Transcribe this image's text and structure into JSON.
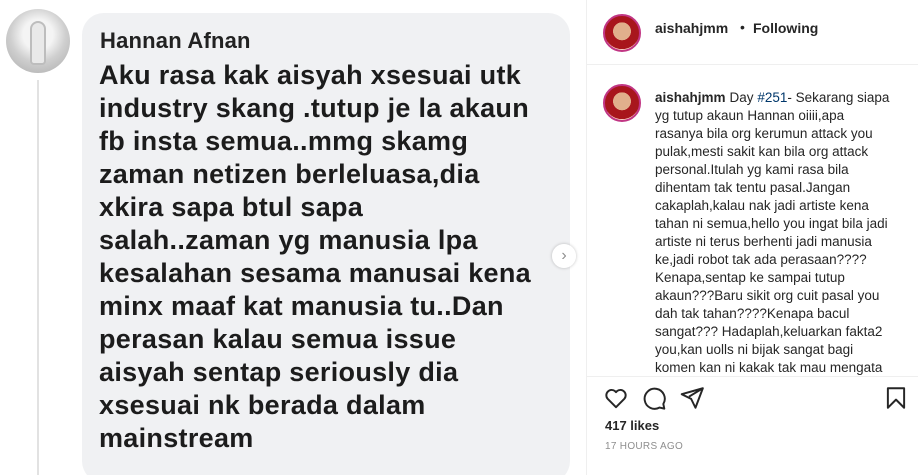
{
  "media": {
    "commenter": "Hannan Afnan",
    "comment_lines": [
      "Aku rasa kak aisyah xsesuai utk",
      "industry skang .tutup je la akaun",
      "fb insta semua..mmg skamg",
      "zaman netizen berleluasa,dia",
      "xkira sapa btul sapa",
      "salah..zaman yg manusia lpa",
      "kesalahan sesama manusai kena",
      "minx maaf kat manusia tu..Dan",
      "perasan kalau semua issue",
      "aisyah sentap seriously dia",
      "xsesuai nk berada dalam",
      "mainstream"
    ]
  },
  "header": {
    "username": "aishahjmm",
    "separator": "•",
    "follow_status": "Following"
  },
  "caption": {
    "username": "aishahjmm",
    "prefix": "Day",
    "hashtag": "#251",
    "text": "- Sekarang siapa yg tutup akaun Hannan oiiii,apa rasanya bila org kerumun attack you pulak,mesti sakit kan bila org attack personal.Itulah yg kami rasa bila dihentam tak tentu pasal.Jangan cakaplah,kalau nak jadi artiste kena tahan ni semua,hello you ingat bila jadi artiste ni terus berhenti jadi manusia ke,jadi robot tak ada perasaan????Kenapa,sentap ke sampai tutup akaun???Baru sikit org cuit pasal you dah tak tahan????Kenapa bacul sangat??? Hadaplah,keluarkan fakta2 you,kan uolls ni bijak sangat bagi komen kan ni kakak tak mau mengata"
  },
  "stats": {
    "likes": "417 likes",
    "time": "17 HOURS AGO"
  },
  "icons": {
    "like": "heart-icon",
    "comment": "comment-icon",
    "share": "share-icon",
    "save": "bookmark-icon",
    "next": "chevron-right-icon"
  }
}
